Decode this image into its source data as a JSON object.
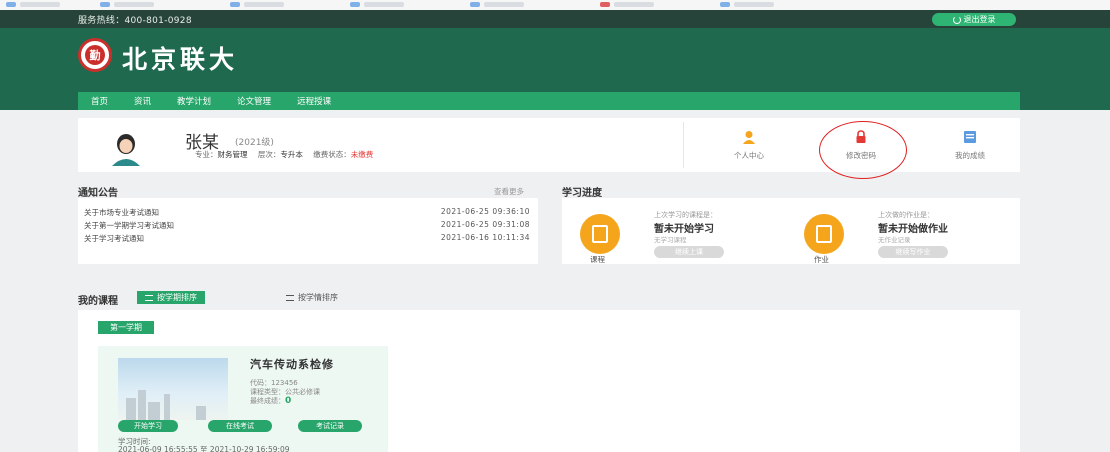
{
  "header": {
    "hotline": "服务热线：400-801-0928",
    "logout_label": "退出登录",
    "brand_name": "北京联大",
    "logo_text": "勤"
  },
  "nav": {
    "items": [
      {
        "label": "首页"
      },
      {
        "label": "资讯"
      },
      {
        "label": "教学计划"
      },
      {
        "label": "论文管理"
      },
      {
        "label": "远程授课"
      }
    ]
  },
  "profile": {
    "name": "张某",
    "grade": "(2021级)",
    "major_label": "专业：",
    "major": "财务管理",
    "level_label": "层次：",
    "level": "专升本",
    "pay_label": "缴费状态：",
    "pay_status": "未缴费",
    "links": [
      {
        "label": "个人中心",
        "icon": "user-icon"
      },
      {
        "label": "修改密码",
        "icon": "lock-icon"
      },
      {
        "label": "我的成绩",
        "icon": "grade-icon"
      }
    ]
  },
  "notices": {
    "title": "通知公告",
    "more": "查看更多",
    "items": [
      {
        "title": "关于市场专业考试通知",
        "date": "2021-06-25 09:36:10"
      },
      {
        "title": "关于第一学期学习考试通知",
        "date": "2021-06-25 09:31:08"
      },
      {
        "title": "关于学习考试通知",
        "date": "2021-06-16 10:11:34"
      }
    ]
  },
  "progress": {
    "title": "学习进度",
    "course": {
      "caption": "课程",
      "last_label": "上次学习的课程是：",
      "status": "暂未开始学习",
      "sub": "无学习课程",
      "button": "继续上课"
    },
    "homework": {
      "caption": "作业",
      "last_label": "上次做的作业是：",
      "status": "暂未开始做作业",
      "sub": "无作业记录",
      "button": "继续写作业"
    }
  },
  "my_courses": {
    "title": "我的课程",
    "sort_by_term": "按学期排序",
    "sort_by_credit": "按学情排序",
    "term_tag": "第一学期",
    "course": {
      "name": "汽车传动系检修",
      "code_label": "代码：",
      "code": "123456",
      "type_label": "课程类型：",
      "type": "公共必修课",
      "score_label": "最终成绩：",
      "score": "0",
      "btn_study": "开始学习",
      "btn_exam": "在线考试",
      "btn_record": "考试记录",
      "time_label": "学习时间:",
      "time_range": "2021-06-09 16:55:55 至 2021-10-29 16:59:09"
    }
  },
  "colors": {
    "brand_green": "#1f6a4e",
    "nav_green": "#27a56a",
    "accent_orange": "#f4a51c",
    "alert_red": "#e53935"
  }
}
